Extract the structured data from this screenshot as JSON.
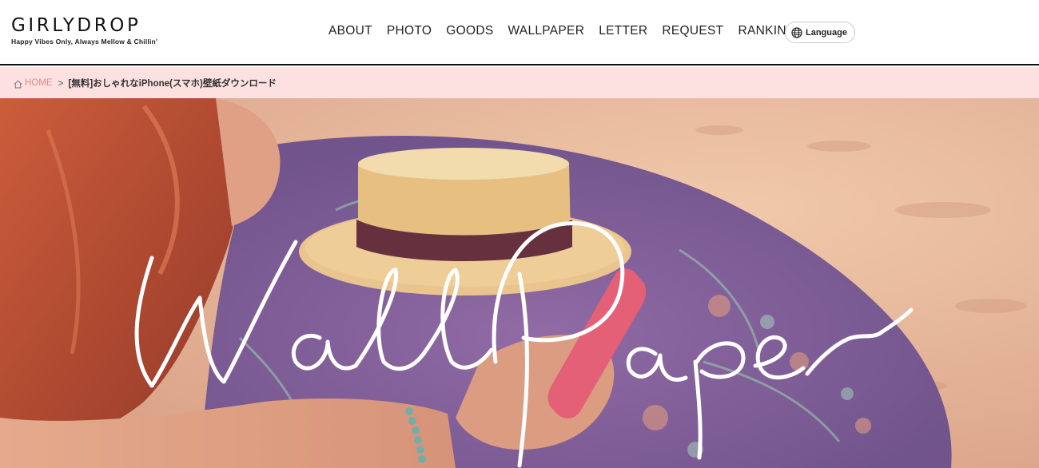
{
  "brand": {
    "name": "GIRLYDROP",
    "tagline": "Happy Vibes Only, Always Mellow & Chillin'"
  },
  "nav": {
    "items": [
      {
        "label": "ABOUT"
      },
      {
        "label": "PHOTO"
      },
      {
        "label": "GOODS"
      },
      {
        "label": "WALLPAPER"
      },
      {
        "label": "LETTER"
      },
      {
        "label": "REQUEST"
      },
      {
        "label": "RANKING"
      }
    ]
  },
  "language": {
    "label": "Language",
    "icon": "globe-icon"
  },
  "breadcrumb": {
    "home": "HOME",
    "home_icon": "home-icon",
    "separator": ">",
    "current": "[無料]おしゃれなiPhone(スマホ)壁紙ダウンロード"
  },
  "hero": {
    "script_title": "Wallpaper",
    "colors": {
      "sand": "#e7b89a",
      "blanket": "#7d5b95",
      "hat": "#e6bd7a",
      "hat_band": "#5e2432",
      "hair": "#b8452a",
      "phone": "#e2576e"
    }
  }
}
